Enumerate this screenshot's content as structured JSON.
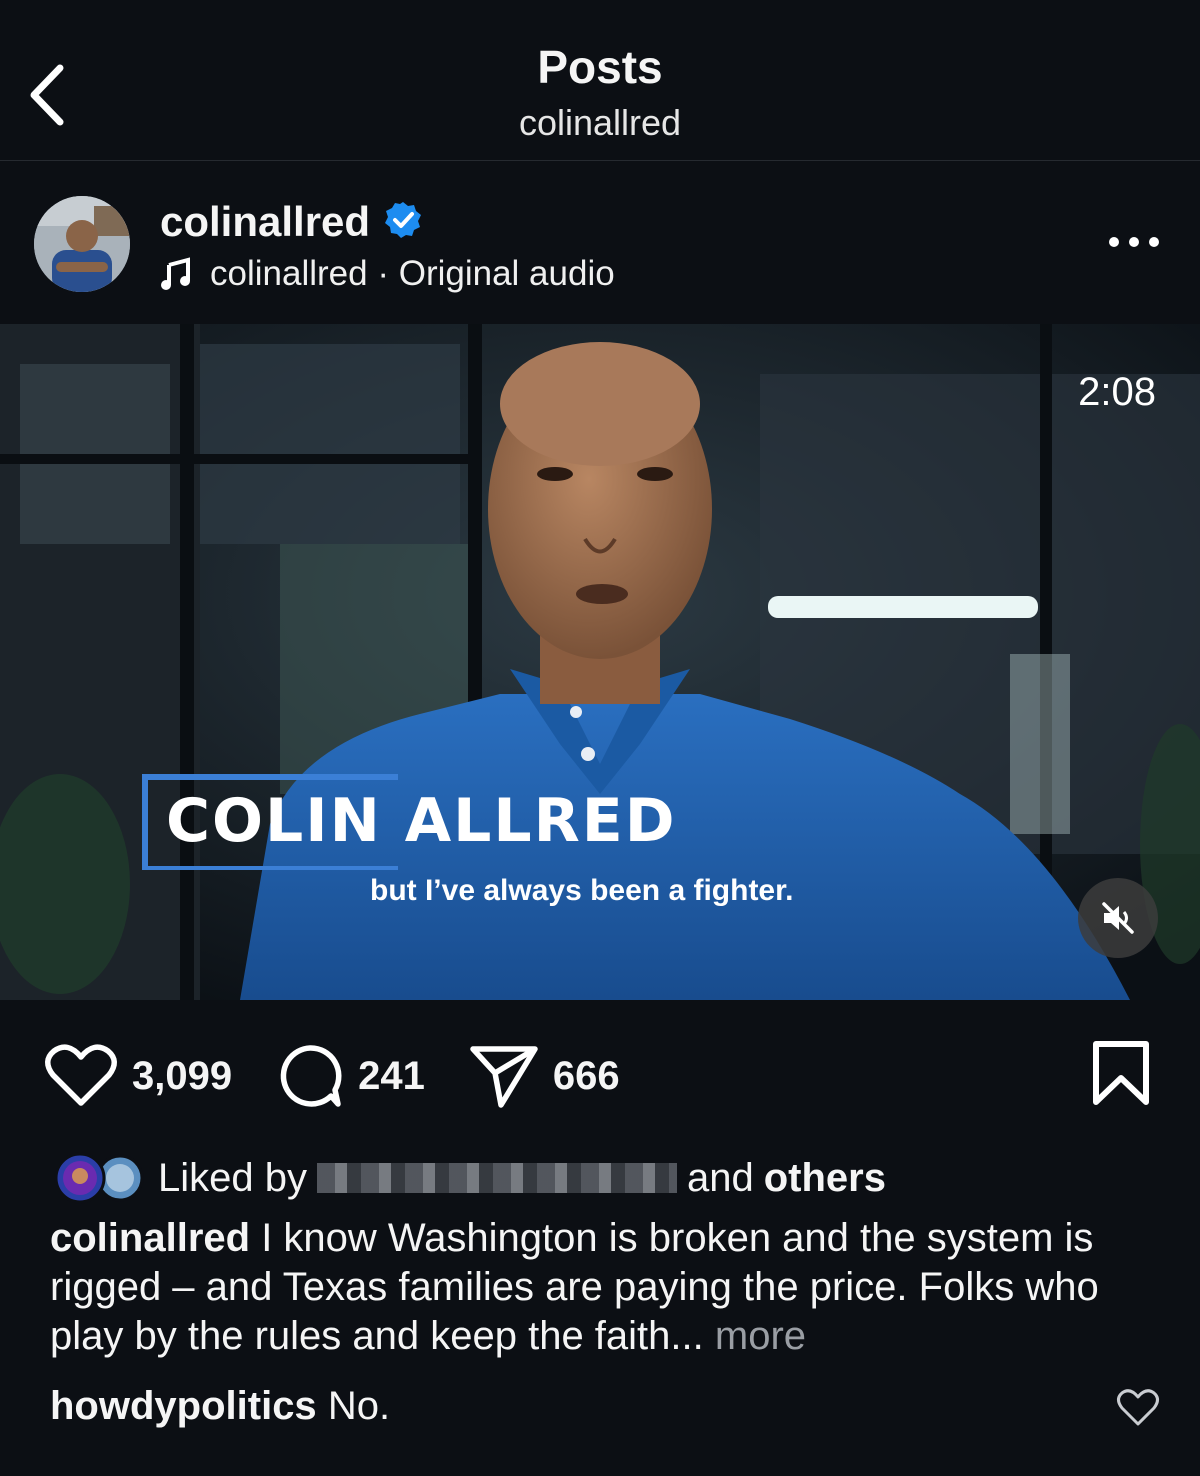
{
  "header": {
    "title": "Posts",
    "subtitle": "colinallred"
  },
  "post": {
    "username": "colinallred",
    "audio_owner": "colinallred",
    "audio_separator": "·",
    "audio_label": "Original audio",
    "video": {
      "duration": "2:08",
      "name_title": "COLIN ALLRED",
      "caption": "but I’ve always been a fighter."
    },
    "actions": {
      "likes": "3,099",
      "comments": "241",
      "shares": "666"
    },
    "liked_by": {
      "prefix": "Liked by",
      "suffix_and": "and",
      "suffix_others": "others"
    },
    "caption": {
      "username": "colinallred",
      "text": "I know Washington is broken and the system is rigged – and Texas families are paying the price. Folks who play by the rules and keep the faith...",
      "more": "more"
    },
    "comment": {
      "username": "howdypolitics",
      "text": "No."
    }
  },
  "colors": {
    "background": "#0c0f14",
    "verified_blue": "#1d8cf0",
    "accent_blue": "#3b7fd6",
    "shirt_blue": "#1f5fa8"
  }
}
